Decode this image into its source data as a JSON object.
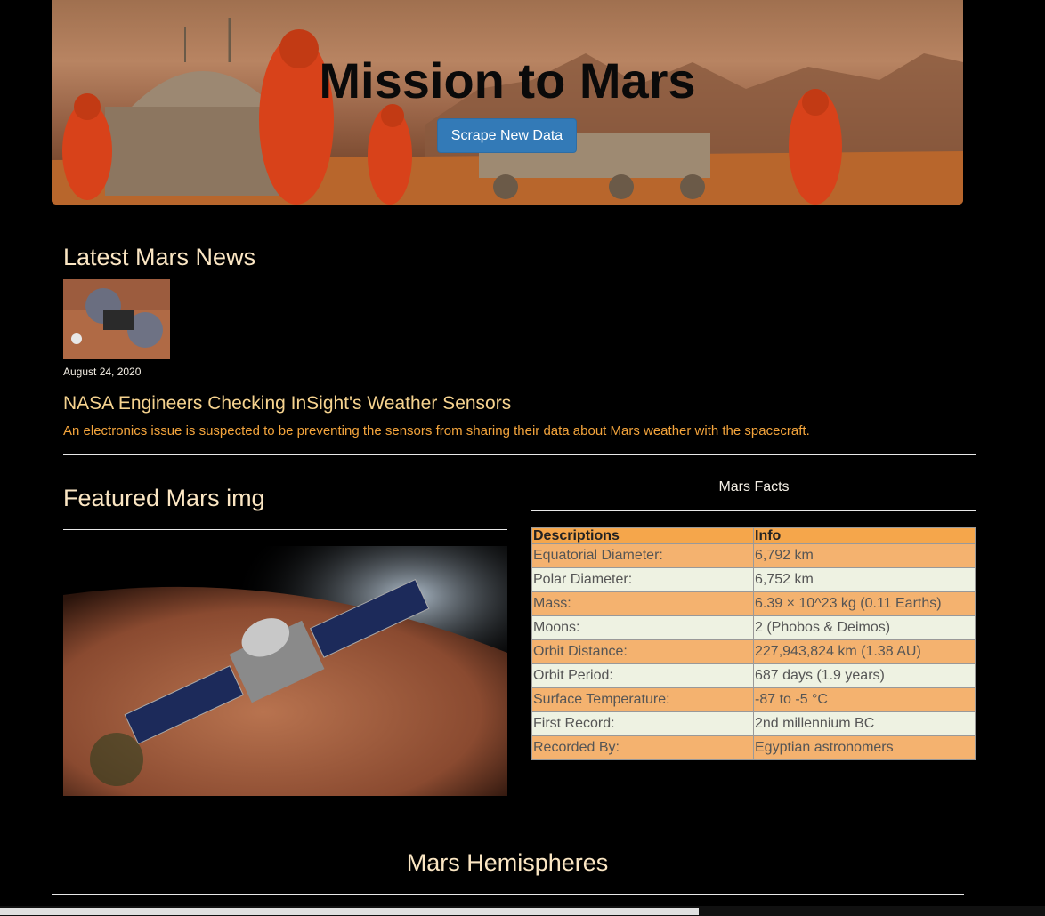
{
  "hero": {
    "title": "Mission to Mars",
    "button_label": "Scrape New Data"
  },
  "news": {
    "section_title": "Latest Mars News",
    "date": "August 24, 2020",
    "headline": "NASA Engineers Checking InSight's Weather Sensors",
    "teaser": "An electronics issue is suspected to be preventing the sensors from sharing their data about Mars weather with the spacecraft."
  },
  "featured": {
    "section_title": "Featured Mars img"
  },
  "facts": {
    "caption": "Mars Facts",
    "headers": [
      "Descriptions",
      "Info"
    ],
    "rows": [
      [
        "Equatorial Diameter:",
        "6,792 km"
      ],
      [
        "Polar Diameter:",
        "6,752 km"
      ],
      [
        "Mass:",
        "6.39 × 10^23 kg (0.11 Earths)"
      ],
      [
        "Moons:",
        "2 (Phobos & Deimos)"
      ],
      [
        "Orbit Distance:",
        "227,943,824 km (1.38 AU)"
      ],
      [
        "Orbit Period:",
        "687 days (1.9 years)"
      ],
      [
        "Surface Temperature:",
        "-87 to -5 °C"
      ],
      [
        "First Record:",
        "2nd millennium BC"
      ],
      [
        "Recorded By:",
        "Egyptian astronomers"
      ]
    ]
  },
  "hemispheres": {
    "section_title": "Mars Hemispheres"
  },
  "colors": {
    "header_orange": "#f5a64b",
    "row_orange": "#f4b26f",
    "row_light": "#eef2e2",
    "button_blue": "#337ab7",
    "headline_gold": "#f6d38f",
    "teaser_orange": "#f3a43c"
  }
}
